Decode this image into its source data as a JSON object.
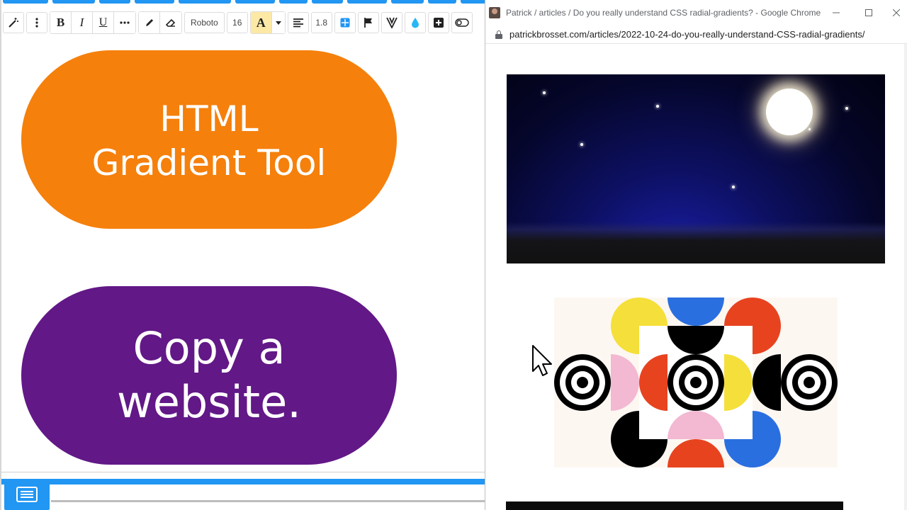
{
  "editor": {
    "toolbar": {
      "font_name": "Roboto",
      "font_size": "16",
      "line_height": "1.8",
      "bold_label": "B",
      "italic_label": "I",
      "underline_label": "U",
      "highlight_label": "A"
    },
    "pills": [
      {
        "text": "HTML\nGradient Tool",
        "color": "#f5800c"
      },
      {
        "text": "Copy a\nwebsite.",
        "color": "#621887"
      }
    ],
    "accent_color": "#2196f3"
  },
  "browser": {
    "tab_title": "Patrick / articles / Do you really understand CSS radial-gradients? - Google Chrome",
    "url": "patrickbrosset.com/articles/2022-10-24-do-you-really-understand-CSS-radial-gradients/",
    "window_controls": [
      "minimize-icon",
      "maximize-icon",
      "close-icon"
    ]
  }
}
